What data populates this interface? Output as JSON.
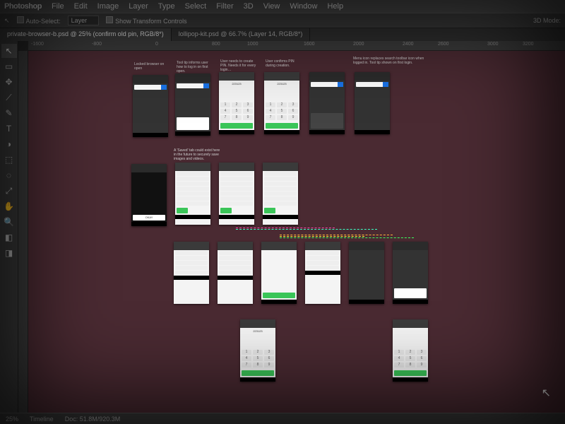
{
  "app": {
    "name": "Photoshop"
  },
  "menubar": [
    "File",
    "Edit",
    "Image",
    "Layer",
    "Type",
    "Select",
    "Filter",
    "3D",
    "View",
    "Window",
    "Help"
  ],
  "optbar": {
    "auto_select_label": "Auto-Select:",
    "auto_select_value": "Layer",
    "transform_label": "Show Transform Controls",
    "mode_label": "3D Mode:"
  },
  "tabs": [
    "private-browser-b.psd @ 25% (confirm old pin, RGB/8*)",
    "lollipop-kit.psd @ 66.7% (Layer 14, RGB/8*)"
  ],
  "ruler_marks": [
    "-1600",
    "-800",
    "0",
    "800",
    "1000",
    "1600",
    "2000",
    "2400",
    "2600",
    "3000",
    "3200"
  ],
  "tools": [
    "↖",
    "▭",
    "✥",
    "⟋",
    "✎",
    "T",
    "◑",
    "⬚",
    "◌",
    "⤢",
    "✋",
    "🔍",
    "◧",
    "◨"
  ],
  "captions": {
    "c0": "Locked browser on open",
    "c1": "Tool tip informs user how to log in on first open.",
    "c2": "User needs to create PIN. Needs it for every login…",
    "c3": "User confirms PIN during creation.",
    "c4": "Menu icon replaces search toolbar icon when logged in. Tool tip shown on first login.",
    "c5": "A 'Saved' tab could exist here in the future to securely save images and videos."
  },
  "pin_display": "223123",
  "statusbar": {
    "zoom": "25%",
    "timeline": "Timeline",
    "doc": "Doc: 51.8M/920.3M"
  }
}
